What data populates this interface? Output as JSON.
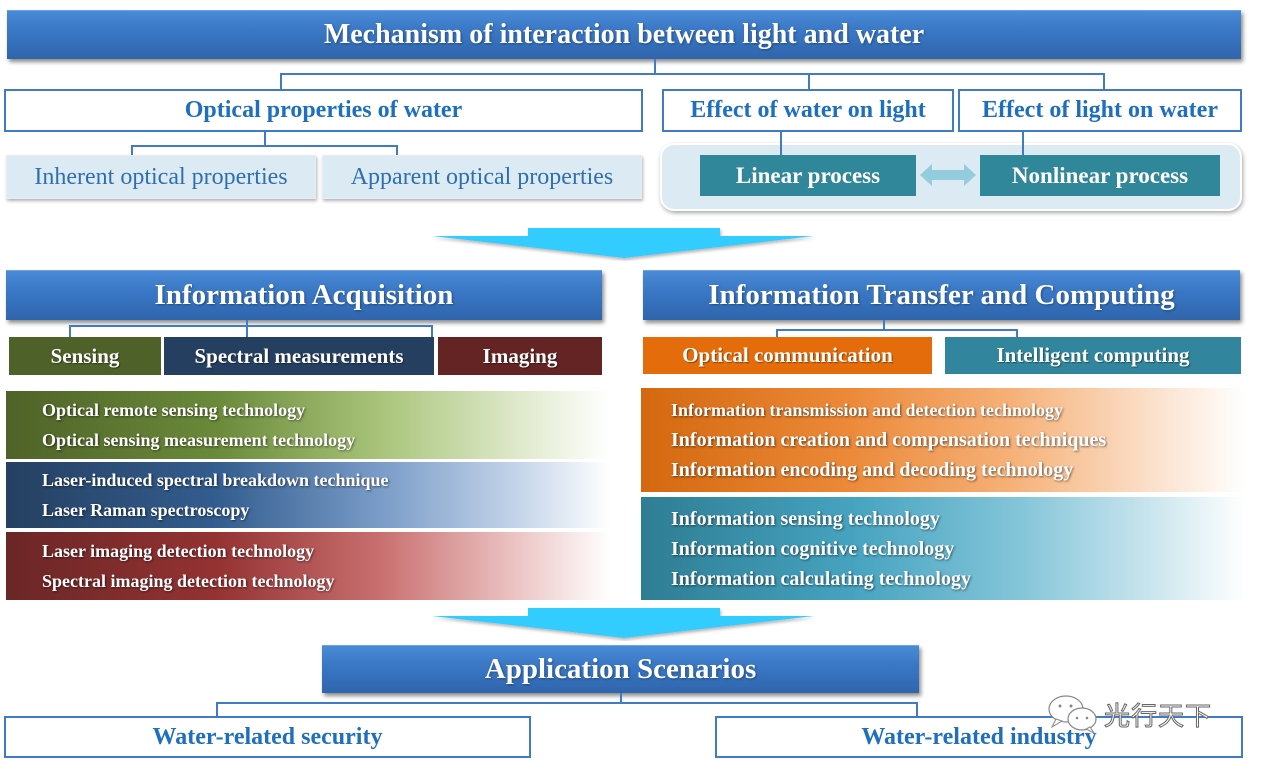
{
  "title": "Mechanism of interaction between light and water",
  "mechanism": {
    "optical_properties": {
      "label": "Optical properties of water",
      "children": [
        "Inherent optical properties",
        "Apparent optical properties"
      ]
    },
    "effect_water_on_light": "Effect of water on light",
    "effect_light_on_water": "Effect of light on water",
    "processes": {
      "linear": "Linear process",
      "nonlinear": "Nonlinear process",
      "connector_icon": "double-arrow-icon"
    }
  },
  "flow_arrow_icon": "down-arrow-icon",
  "acquisition": {
    "title": "Information Acquisition",
    "categories": [
      {
        "label": "Sensing",
        "color": "#4e6128"
      },
      {
        "label": "Spectral measurements",
        "color": "#253f60"
      },
      {
        "label": "Imaging",
        "color": "#632423"
      }
    ],
    "groups": [
      {
        "items": [
          "Optical remote sensing technology",
          "Optical sensing measurement technology"
        ],
        "color": "#4f6228"
      },
      {
        "items": [
          "Laser-induced spectral breakdown technique",
          "Laser Raman spectroscopy"
        ],
        "color": "#254061"
      },
      {
        "items": [
          "Laser imaging detection technology",
          "Spectral imaging detection technology"
        ],
        "color": "#6b2626"
      }
    ]
  },
  "transfer": {
    "title": "Information Transfer and Computing",
    "categories": [
      {
        "label": "Optical communication",
        "color": "#e46c0a"
      },
      {
        "label": "Intelligent computing",
        "color": "#31859c"
      }
    ],
    "groups": [
      {
        "items": [
          "Information transmission and detection technology",
          "Information creation and compensation techniques",
          "Information encoding and decoding technology"
        ],
        "color": "#d4680e"
      },
      {
        "items": [
          "Information sensing technology",
          "Information cognitive technology",
          "Information calculating technology"
        ],
        "color": "#2e7d93"
      }
    ]
  },
  "applications": {
    "title": "Application Scenarios",
    "items": [
      "Water-related security",
      "Water-related industry"
    ]
  },
  "watermark": {
    "icon": "wechat-icon",
    "text": "光行天下"
  }
}
